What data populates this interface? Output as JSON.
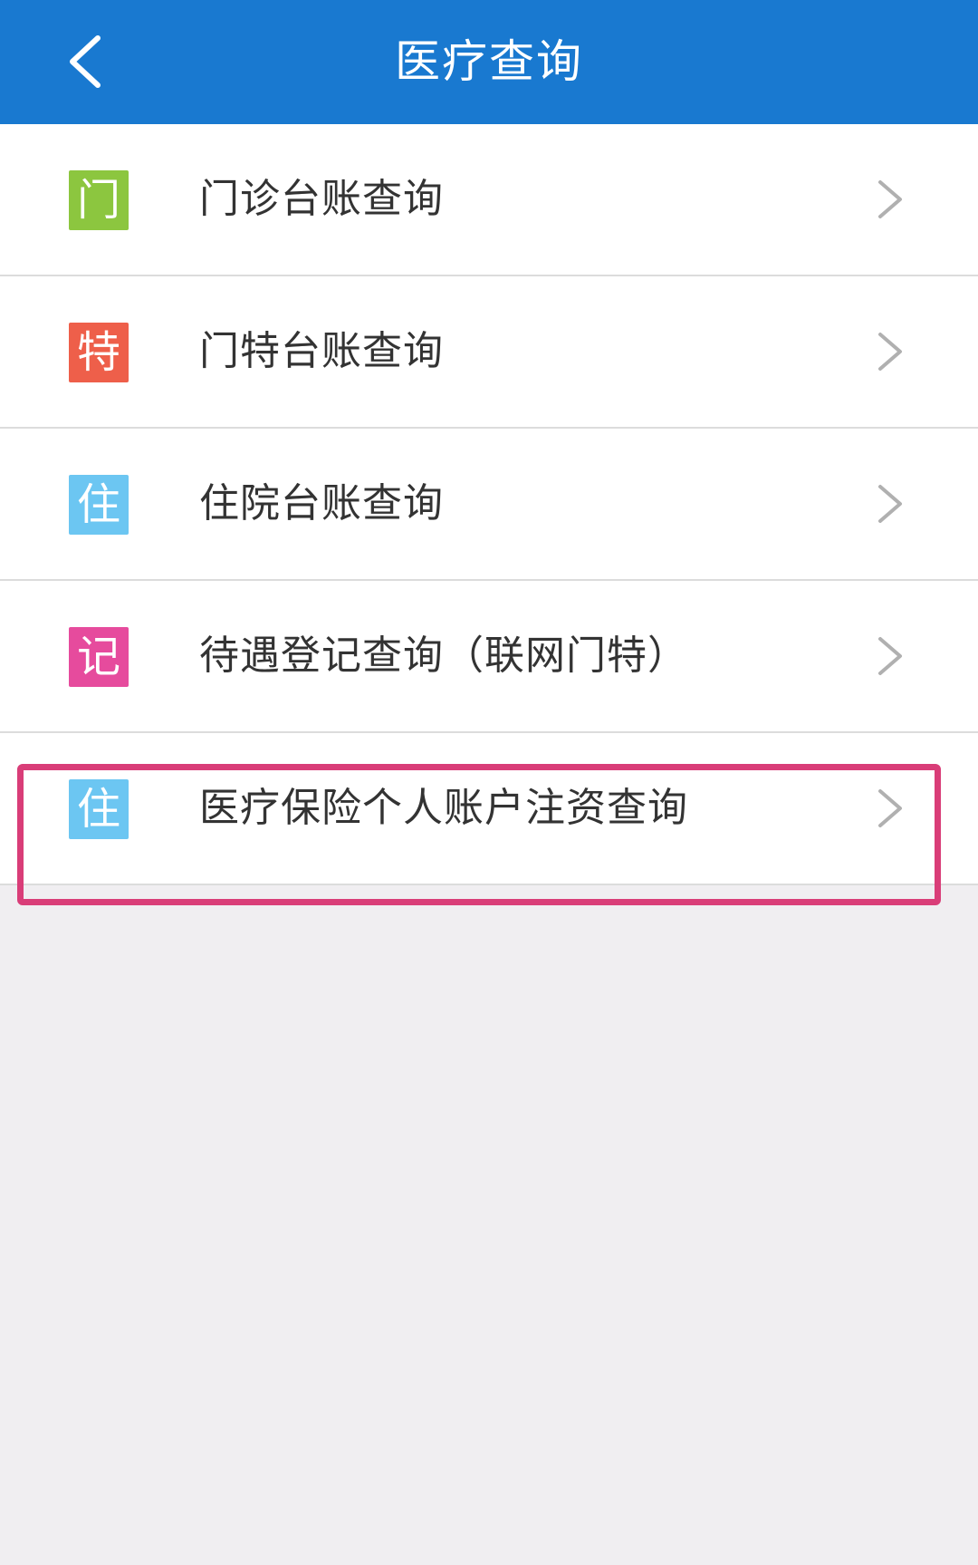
{
  "header": {
    "title": "医疗查询",
    "back_icon": "chevron-left-icon"
  },
  "menu": [
    {
      "badge": "门",
      "badge_color": "#8cc63f",
      "label": "门诊台账查询"
    },
    {
      "badge": "特",
      "badge_color": "#ee5f4a",
      "label": "门特台账查询"
    },
    {
      "badge": "住",
      "badge_color": "#6cc6f2",
      "label": "住院台账查询"
    },
    {
      "badge": "记",
      "badge_color": "#e64b9d",
      "label": "待遇登记查询（联网门特）"
    },
    {
      "badge": "住",
      "badge_color": "#6cc6f2",
      "label": "医疗保险个人账户注资查询"
    }
  ],
  "colors": {
    "header_bg": "#1979d0",
    "page_bg": "#f0eef1",
    "highlight_border": "#d93d78",
    "chevron": "#b0b0b0"
  }
}
